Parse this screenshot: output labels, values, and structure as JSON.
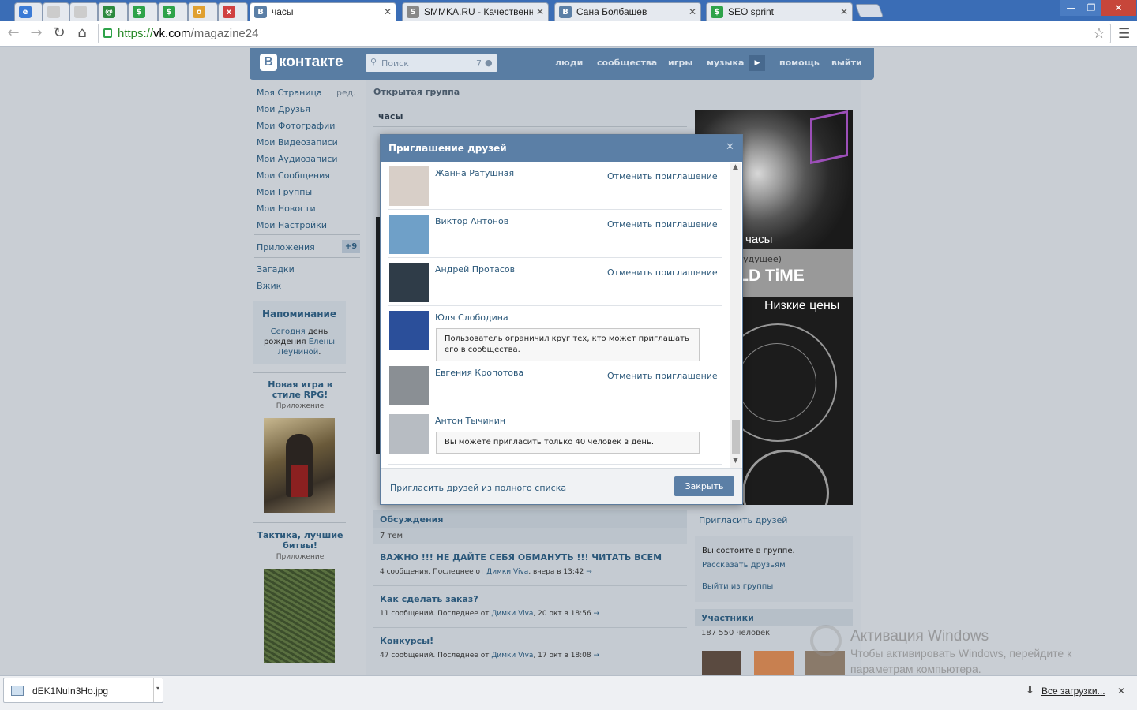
{
  "browser": {
    "tabs": [
      {
        "label": "",
        "color": "#3b7bd6",
        "glyph": "e"
      },
      {
        "label": "",
        "color": "#cccccc",
        "glyph": ""
      },
      {
        "label": "",
        "color": "#cccccc",
        "glyph": ""
      },
      {
        "label": "",
        "color": "#2c8a3f",
        "glyph": "@"
      },
      {
        "label": "",
        "color": "#2ea34a",
        "glyph": "$"
      },
      {
        "label": "",
        "color": "#2ea34a",
        "glyph": "$"
      },
      {
        "label": "",
        "color": "#e0a030",
        "glyph": "o"
      },
      {
        "label": "",
        "color": "#d04040",
        "glyph": "x"
      },
      {
        "label": "часы",
        "color": "#5b7fa6",
        "glyph": "B"
      },
      {
        "label": "SMMKA.RU - Качественн",
        "color": "#888888",
        "glyph": "S"
      },
      {
        "label": "Сана Болбашев",
        "color": "#5b7fa6",
        "glyph": "B"
      },
      {
        "label": "SEO sprint",
        "color": "#2ea34a",
        "glyph": "$"
      }
    ],
    "url_scheme": "https://",
    "url_host": "vk.com",
    "url_path": "/magazine24"
  },
  "vk": {
    "logo": "контакте",
    "logo_letter": "В",
    "search_placeholder": "Поиск",
    "search_count": "7",
    "nav": [
      "люди",
      "сообщества",
      "игры",
      "музыка",
      "помощь",
      "выйти"
    ],
    "left_menu": [
      {
        "label": "Моя Страница",
        "extra": "ред."
      },
      {
        "label": "Мои Друзья"
      },
      {
        "label": "Мои Фотографии"
      },
      {
        "label": "Мои Видеозаписи"
      },
      {
        "label": "Мои Аудиозаписи"
      },
      {
        "label": "Мои Сообщения"
      },
      {
        "label": "Мои Группы"
      },
      {
        "label": "Мои Новости"
      },
      {
        "label": "Мои Настройки"
      },
      {
        "label": "Приложения",
        "badge": "+9"
      },
      {
        "label": "Загадки"
      },
      {
        "label": "Вжик"
      }
    ],
    "reminder": {
      "title": "Напоминание",
      "text1": "Сегодня",
      "text2": "день рождения",
      "name": "Елены Леуниной",
      "dot": "."
    },
    "ads": [
      {
        "title": "Новая игра в стиле RPG!",
        "sub": "Приложение"
      },
      {
        "title": "Тактика, лучшие битвы!",
        "sub": "Приложение"
      }
    ],
    "group": {
      "type": "Открытая группа",
      "name": "часы",
      "banner_line1": "часы",
      "banner_line2": "(будущее)",
      "banner_line3": "RLD TiME",
      "banner_line4": "Низкие цены",
      "invite_friends": "Пригласить друзей",
      "member_status": "Вы состоите в группе.",
      "tell_friends": "Рассказать друзьям",
      "leave_group": "Выйти из группы",
      "members_title": "Участники",
      "members_count": "187 550 человек"
    },
    "discussions": {
      "title": "Обсуждения",
      "count": "7 тем",
      "topics": [
        {
          "title": "ВАЖНО !!! НЕ ДАЙТЕ СЕБЯ ОБМАНУТЬ !!! ЧИТАТЬ ВСЕМ",
          "meta": "4 сообщения. Последнее от",
          "author": "Димки Viva",
          "time": ", вчера в 13:42"
        },
        {
          "title": "Как сделать заказ?",
          "meta": "11 сообщений. Последнее от",
          "author": "Димки Viva",
          "time": ", 20 окт в 18:56"
        },
        {
          "title": "Конкурсы!",
          "meta": "47 сообщений. Последнее от",
          "author": "Димки Viva",
          "time": ", 17 окт в 18:08"
        }
      ],
      "arrow": "→"
    }
  },
  "modal": {
    "title": "Приглашение друзей",
    "close_glyph": "✕",
    "cancel_label": "Отменить приглашение",
    "friends": [
      {
        "name": "Жанна Ратушная",
        "state": "invited",
        "ava": "#d8cfc8"
      },
      {
        "name": "Виктор Антонов",
        "state": "invited",
        "ava": "#6fa0c8"
      },
      {
        "name": "Андрей Протасов",
        "state": "invited",
        "ava": "#2f3c48"
      },
      {
        "name": "Юля Слободина",
        "state": "restricted",
        "ava": "#2b4f9a",
        "message": "Пользователь ограничил круг тех, кто может приглашать его в сообщества."
      },
      {
        "name": "Евгения Кропотова",
        "state": "invited",
        "ava": "#8a8f94"
      },
      {
        "name": "Антон Тычинин",
        "state": "limit",
        "ava": "#b7bcc2",
        "message": "Вы можете пригласить только 40 человек в день."
      }
    ],
    "footer_link": "Пригласить друзей из полного списка",
    "close_button": "Закрыть"
  },
  "watermark": {
    "title": "Активация Windows",
    "line1": "Чтобы активировать Windows, перейдите к",
    "line2": "параметрам компьютера."
  },
  "downloads": {
    "file": "dEK1NuIn3Ho.jpg",
    "all": "Все загрузки...",
    "close": "✕"
  }
}
